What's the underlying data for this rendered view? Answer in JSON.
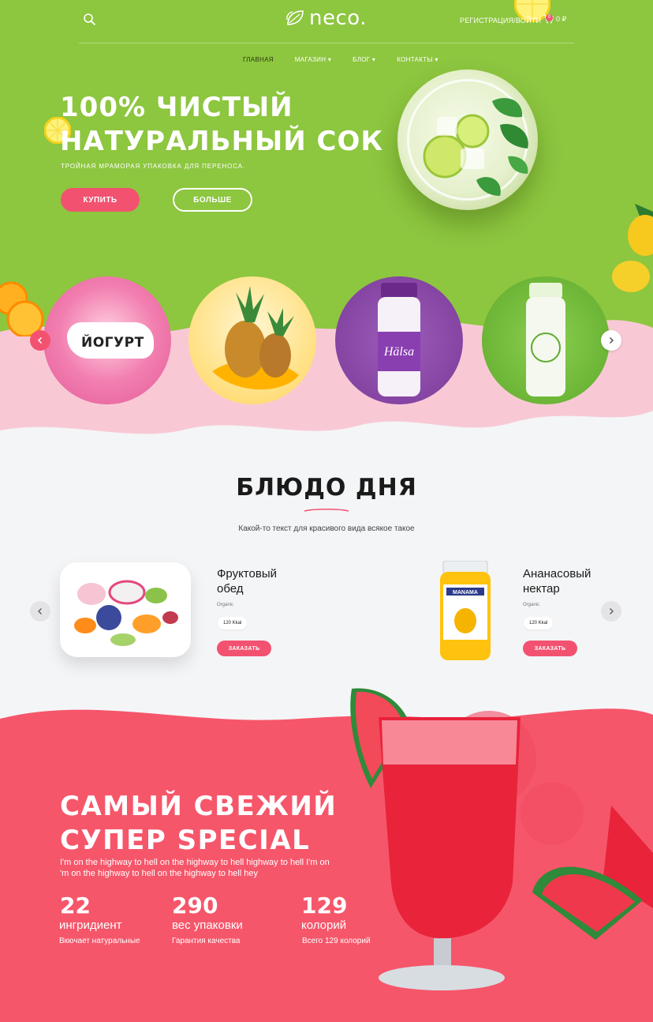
{
  "header": {
    "logo_text": "neco.",
    "login_label": "РЕГИСТРАЦИЯ/ВОЙТИ",
    "cart_count": "0",
    "cart_label": "0 ₽"
  },
  "nav": {
    "items": [
      {
        "label": "ГЛАВНАЯ"
      },
      {
        "label": "МАГАЗИН ▾"
      },
      {
        "label": "БЛОГ ▾"
      },
      {
        "label": "КОНТАКТЫ ▾"
      }
    ]
  },
  "hero": {
    "title_line1": "100% ЧИСТЫЙ",
    "title_line2": "НАТУРАЛЬНЫЙ СОК",
    "subtitle": "ТРОЙНАЯ МРАМОРАЯ УПАКОВКА ДЛЯ ПЕРЕНОСА.",
    "buy_label": "КУПИТЬ",
    "more_label": "БОЛЬШЕ"
  },
  "categories": {
    "items": [
      {
        "label": "ЙОГУРТ"
      },
      {
        "label": ""
      },
      {
        "label": ""
      },
      {
        "label": ""
      }
    ]
  },
  "dish": {
    "title": "БЛЮДО ДНЯ",
    "subtitle": "Какой-то текст для красивого вида всякое такое",
    "products": [
      {
        "name_line1": "Фруктовый",
        "name_line2": "обед",
        "tag": "Organic",
        "kcal": "120 Kkal",
        "button": "ЗАКАЗАТЬ"
      },
      {
        "name_line1": "Ананасовый",
        "name_line2": "нектар",
        "tag": "Organic",
        "kcal": "120 Kkal",
        "button": "ЗАКАЗАТЬ"
      }
    ]
  },
  "special": {
    "title_line1": "САМЫЙ СВЕЖИЙ",
    "title_line2": "СУПЕР SPECIAL",
    "text_line1": "I'm on the highway to hell on the highway to hell highway to hell I'm on",
    "text_line2": "'m on the highway to hell on the highway to hell hey",
    "stats": [
      {
        "value": "22",
        "label": "ингридиент",
        "desc": "Вкючает натуральные"
      },
      {
        "value": "290",
        "label": "вес упаковки",
        "desc": "Гарантия качества"
      },
      {
        "value": "129",
        "label": "колорий",
        "desc": "Всего 129 колорий"
      }
    ]
  },
  "colors": {
    "hero_green": "#8dc63f",
    "accent_pink": "#f25270",
    "light_pink": "#f8c9d5",
    "special_red": "#f6566a"
  },
  "icons": {
    "search": "search-icon",
    "cart": "cart-icon",
    "leaf": "leaf-icon",
    "arrow_left": "chevron-left-icon",
    "arrow_right": "chevron-right-icon"
  }
}
